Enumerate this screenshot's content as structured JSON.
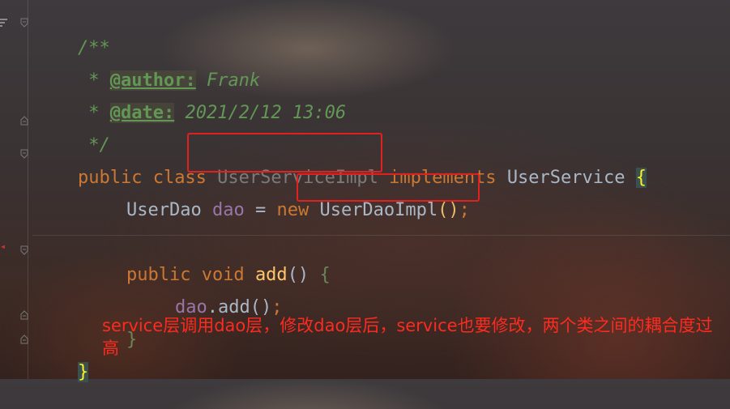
{
  "editor": {
    "doc_open": "/**",
    "doc_author_prefix": " * ",
    "doc_author_tag": "@author:",
    "doc_author_value": " Frank",
    "doc_date_prefix": " * ",
    "doc_date_tag": "@date:",
    "doc_date_value": " 2021/2/12 13:06",
    "doc_close": " */",
    "class_kw": "public class ",
    "class_name": "UserServiceImpl",
    "implements_kw": " implements ",
    "interface_name": "UserService",
    "class_open_brace": "{",
    "field_type": "UserDao",
    "field_name": "dao",
    "assign": " = ",
    "new_kw": "new",
    "impl_name": "UserDaoImpl",
    "impl_parens": "()",
    "impl_semi": ";",
    "method_kw": "public void ",
    "method_name": "add",
    "method_parens": "()",
    "method_open_brace": "{",
    "call_target": "dao",
    "call_dot": ".",
    "call_method": "add",
    "call_parens": "()",
    "call_semi": ";",
    "method_close_brace": "}",
    "class_close_brace": "}"
  },
  "annotation": {
    "text": "service层调用dao层，修改dao层后，service也要修改，两个类之间的耦合度过高"
  },
  "colors": {
    "highlight_box": "#e0211f",
    "annotation_text": "#ff2a1f",
    "keyword": "#cc7832",
    "doc_comment": "#629755"
  }
}
